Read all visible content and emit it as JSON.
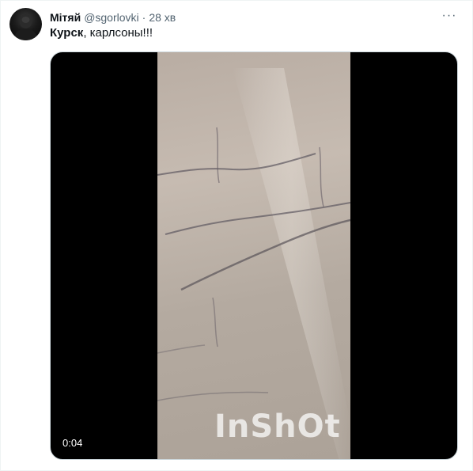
{
  "tweet": {
    "author_name": "Мітяй",
    "author_handle": "@sgorlovki",
    "separator": "·",
    "timestamp": "28 хв",
    "more_icon": "ellipsis-icon",
    "text_bold": "Курск",
    "text_rest": ", карлсоны!!!"
  },
  "media": {
    "type": "video",
    "watermark": "InShOt",
    "duration": "0:04",
    "background_color": "#000000"
  },
  "colors": {
    "primary_text": "#0f1419",
    "secondary_text": "#536471"
  }
}
